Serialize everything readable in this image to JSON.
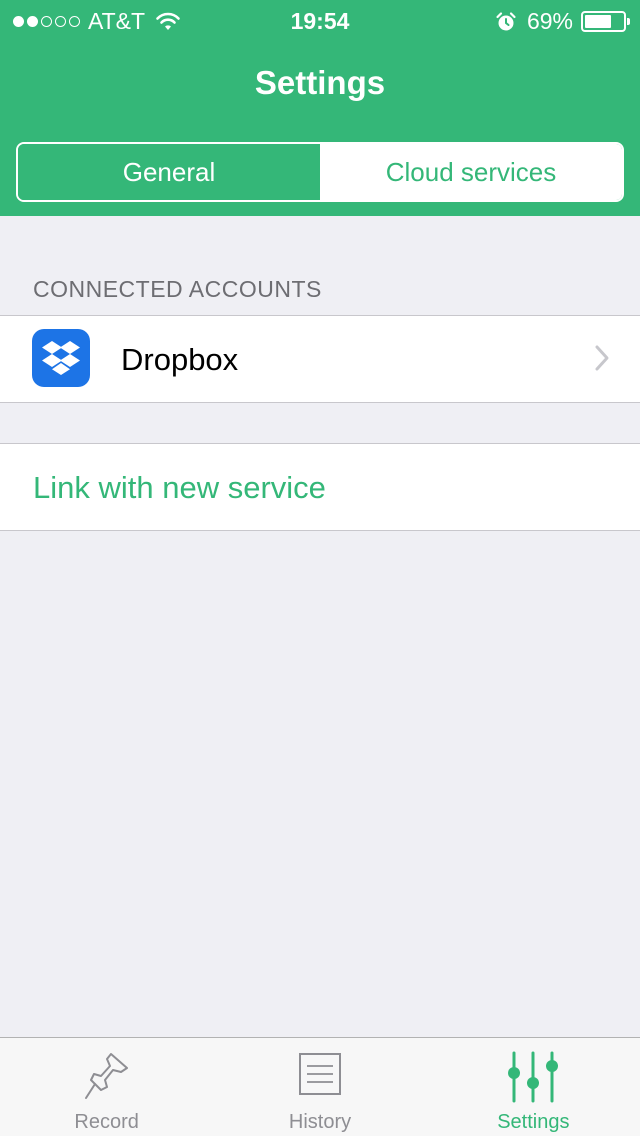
{
  "status_bar": {
    "carrier": "AT&T",
    "time": "19:54",
    "battery_percent": "69%",
    "battery_level": 0.69,
    "signal_strength": 2,
    "signal_max": 5
  },
  "nav": {
    "title": "Settings"
  },
  "segments": {
    "general": "General",
    "cloud": "Cloud services",
    "selected": "general"
  },
  "section": {
    "header": "CONNECTED ACCOUNTS"
  },
  "accounts": [
    {
      "name": "Dropbox",
      "icon": "dropbox-icon"
    }
  ],
  "link_action": "Link with new service",
  "tabbar": {
    "items": [
      {
        "label": "Record",
        "icon": "pushpin-icon"
      },
      {
        "label": "History",
        "icon": "list-icon"
      },
      {
        "label": "Settings",
        "icon": "sliders-icon"
      }
    ],
    "selected_index": 2
  },
  "colors": {
    "accent": "#34b778",
    "background": "#efeff4",
    "dropbox_blue": "#1d74e6",
    "inactive_gray": "#8e8e93"
  }
}
